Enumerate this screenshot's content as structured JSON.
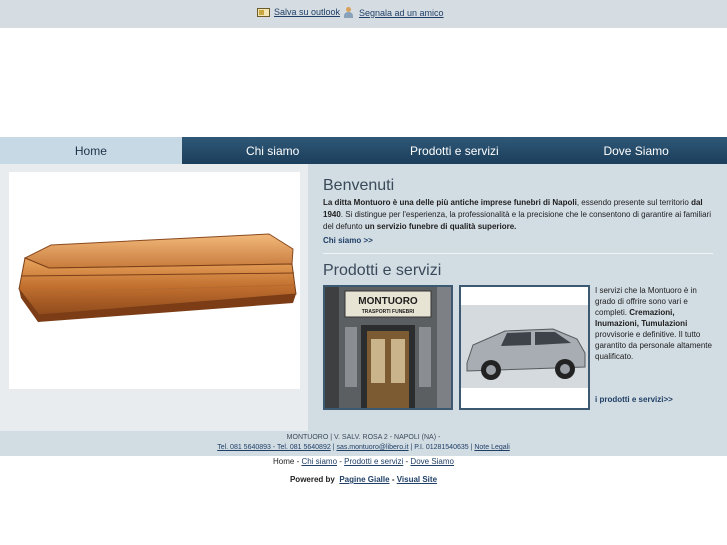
{
  "topbar": {
    "save_outlook": "Salva su outlook",
    "tell_friend": "Segnala ad un amico"
  },
  "nav": {
    "items": [
      {
        "label": "Home"
      },
      {
        "label": "Chi siamo"
      },
      {
        "label": "Prodotti e servizi"
      },
      {
        "label": "Dove Siamo"
      }
    ],
    "active_index": 0
  },
  "welcome": {
    "title": "Benvenuti",
    "p1_b1": "La ditta Montuoro è una delle più antiche imprese funebri di Napoli",
    "p1_t1": ", essendo presente sul territorio ",
    "p1_b2": "dal 1940",
    "p1_t2": ". Si distingue per l'esperienza, la professionalità e la precisione che le consentono di garantire ai familiari del defunto ",
    "p1_b3": "un servizio funebre di qualità superiore.",
    "link": "Chi siamo >>"
  },
  "services": {
    "title": "Prodotti e servizi",
    "t1": "I servizi che la Montuoro è in grado di offrire sono vari e completi. ",
    "b1": "Cremazioni, Inumazioni, Tumulazioni",
    "t2": " provvisorie e definitive. Il tutto garantito da personale altamente qualificato.",
    "link": "i prodotti e servizi>>",
    "shop_sign": "MONTUORO",
    "shop_sub": "TRASPORTI FUNEBRI"
  },
  "footer": {
    "address": "MONTUORO | V. SALV. ROSA 2 - NAPOLI (NA) -",
    "tel": "Tel. 081 5640893 - Tel. 081 5640892",
    "email": "sas.montuoro@libero.it",
    "piva": " | P.I. 01281540635 | ",
    "legal": "Note Legali",
    "nav_home": "Home",
    "nav_chi": "Chi siamo",
    "nav_prod": "Prodotti e servizi",
    "nav_dove": "Dove Siamo",
    "powered_label": "Powered by",
    "pagine": "Pagine Gialle",
    "visual": "Visual Site"
  },
  "colors": {
    "nav_bg": "#1b3e5c",
    "nav_active": "#c8d9e6",
    "panel_bg": "#d2dce3",
    "link": "#1f3f66"
  }
}
